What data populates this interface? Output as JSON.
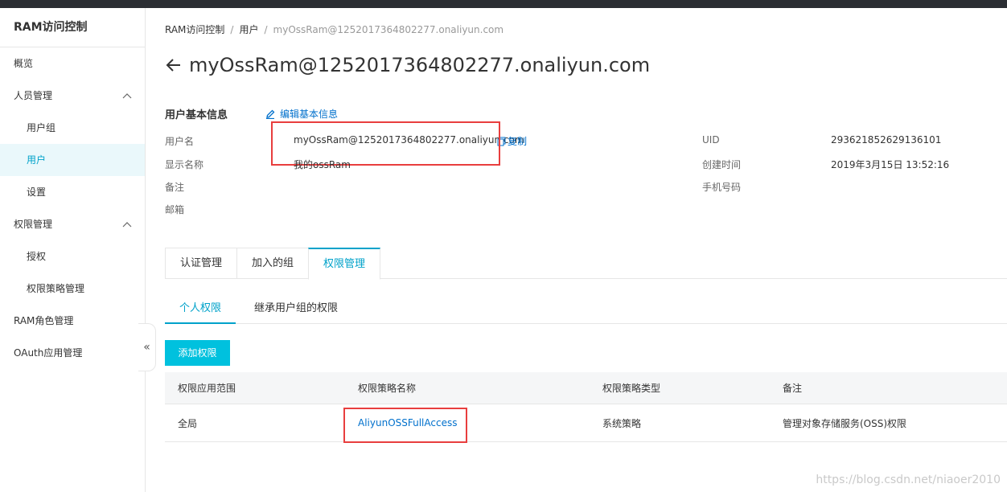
{
  "sidebar": {
    "title": "RAM访问控制",
    "items": [
      {
        "label": "概览"
      },
      {
        "label": "人员管理"
      },
      {
        "label": "用户组"
      },
      {
        "label": "用户"
      },
      {
        "label": "设置"
      },
      {
        "label": "权限管理"
      },
      {
        "label": "授权"
      },
      {
        "label": "权限策略管理"
      },
      {
        "label": "RAM角色管理"
      },
      {
        "label": "OAuth应用管理"
      }
    ],
    "collapse_glyph": "«"
  },
  "breadcrumb": {
    "items": [
      "RAM访问控制",
      "用户",
      "myOssRam@1252017364802277.onaliyun.com"
    ],
    "separator": "/"
  },
  "page": {
    "title": "myOssRam@1252017364802277.onaliyun.com"
  },
  "user_info": {
    "section_title": "用户基本信息",
    "edit_label": "编辑基本信息",
    "copy_label": "复制",
    "fields": {
      "username_label": "用户名",
      "username_value": "myOssRam@1252017364802277.onaliyun.com",
      "display_name_label": "显示名称",
      "display_name_value": "我的ossRam",
      "note_label": "备注",
      "email_label": "邮箱",
      "uid_label": "UID",
      "uid_value": "293621852629136101",
      "created_label": "创建时间",
      "created_value": "2019年3月15日 13:52:16",
      "phone_label": "手机号码"
    }
  },
  "tabs": [
    {
      "label": "认证管理"
    },
    {
      "label": "加入的组"
    },
    {
      "label": "权限管理"
    }
  ],
  "subtabs": [
    {
      "label": "个人权限"
    },
    {
      "label": "继承用户组的权限"
    }
  ],
  "add_button_label": "添加权限",
  "table": {
    "headers": [
      "权限应用范围",
      "权限策略名称",
      "权限策略类型",
      "备注"
    ],
    "rows": [
      [
        "全局",
        "AliyunOSSFullAccess",
        "系统策略",
        "管理对象存储服务(OSS)权限"
      ]
    ]
  },
  "watermark": "https://blog.csdn.net/niaoer2010",
  "colors": {
    "accent": "#00a2ca",
    "button": "#00c1de",
    "link": "#0070cc",
    "highlight": "#e83e3e"
  },
  "icons": [
    "back-arrow-icon",
    "edit-icon",
    "copy-icon",
    "chevron-up-icon",
    "collapse-icon"
  ]
}
